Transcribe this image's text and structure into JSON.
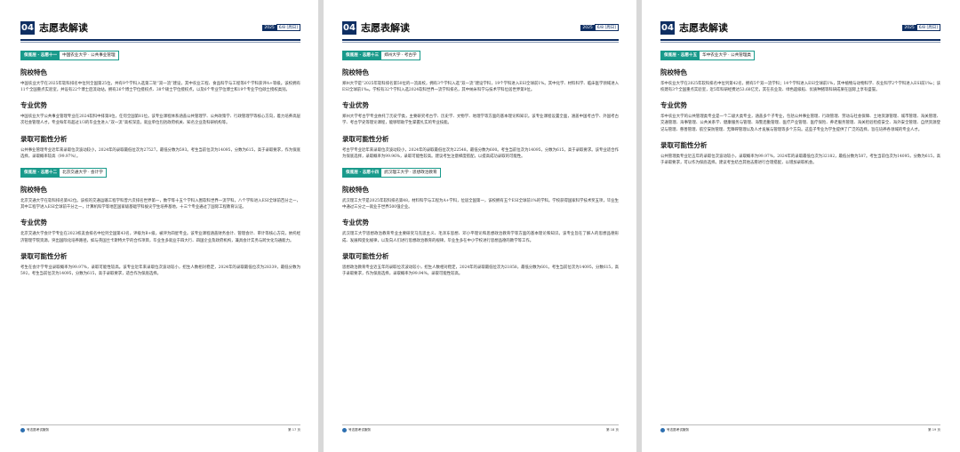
{
  "header": {
    "number": "04",
    "title": "志愿表解读",
    "year": "2025",
    "month_day": "6/8",
    "weekday": "[周日]"
  },
  "footer": {
    "brand": "号志愿考试服务"
  },
  "pages": [
    {
      "page_number": "第 17 页",
      "blocks": [
        {
          "tag_kind": "保底层 · 志愿十一",
          "tag_name": "中国农业大学 · 公共事业管理",
          "sections": [
            {
              "heading": "院校特色",
              "text": "中国农业大学在2025年软科排名中位列全国第25位，共有9个学科入选第二轮“双一流”建设，其中农业工程、食品科学与工程等6个学科获评A+等级。该校拥有11个全国重点实验室，并设有22个博士后流动站，拥有26个博士学位授权点、38个硕士学位授权点，以及6个专业学位博士和19个专业学位硕士授权类别。"
            },
            {
              "heading": "专业优势",
              "text": "中国农业大学公共事业管理专业在2024软科中排第8位，任何全国第81位。该专业课程体系涵盖公共管理学、公共政策学、行政管理学等核心方向，着力培养高层次社会管理人才。专业每年有超过1/3的毕业生进入“双一流”高校深造，就业单位包括政府机关、知名企业及科研机构等。"
            },
            {
              "heading": "录取可能性分析",
              "text": "公共事业管理专业近年来录取位次波动较小，2024年的录取最低位次为27527，最低分数为593。考生当前位次为14095，分数为615，高于录取要求，作为保底选择，录取概率较高（99.97%）。"
            }
          ]
        },
        {
          "tag_kind": "保底层 · 志愿十二",
          "tag_name": "北京交通大学 · 会计学",
          "sections": [
            {
              "heading": "院校特色",
              "text": "北京交通大学在软科排名第42位。该校的交通运输工程学科曾六次排名世界第一，数学等十五个学科入围软科世界一流学科，八个学科进入ESI全球前百分之一，其中工程学进入ESI全球前千分之一，计算机科学等地区国家级基础学科拔尖学生培养基地，十三个专业通过了国际工程教育认证。"
            },
            {
              "heading": "专业优势",
              "text": "北京交通大学会计学专业在2023校友会排名中位列全国第43名，评级为B+级，被评为四星专业。该专业课程涵盖财务会计、管理会计、审计等核心方向，依托经济管理学院资源，突出国际化培养路径，如与英国兰卡斯特大学的合作项目，毕业生多就业于四大行、四国企业及政府机构，兼具会计实务与跨文化沟通能力。"
            },
            {
              "heading": "录取可能性分析",
              "text": "考生在会计学专业录取概率为99.97%，录取可能性较高。该专业近年来录取位次波动较小，招生人数相对稳定，2024年的录取最低位次为28339，最低分数为592，考生当前位次为14095，分数为615，高于录取要求，适合作为保底选择。"
            }
          ]
        }
      ]
    },
    {
      "page_number": "第 18 页",
      "blocks": [
        {
          "tag_kind": "保底层 · 志愿十三",
          "tag_name": "郑州大学 · 考古学",
          "sections": [
            {
              "heading": "院校特色",
              "text": "郑州大学是“2025年软科排名第50位的一流高校，拥有3个学科入选“双一流”建设学科，19个学科进入ESI全球前1%。其中化学、材料科学、临床医学领域进入ESI全球前1‰。学校有32个学科入选2024软科世界一流学科排名，其中纳米科学与技术学科位居世界第9位。"
            },
            {
              "heading": "专业优势",
              "text": "郑州大学考古学专业依托了历史学类，主要研究考古学、历史学、文物学、地理学等方面的基本理论和知识。该专业课程设置全面，涵盖中国考古学、外国考古学、考古学史等理论课程，能够帮助学生掌握扎实的专业技能。"
            },
            {
              "heading": "录取可能性分析",
              "text": "考古学专业近年来录取位次波动较小，2024年的录取最低位次为22548，最低分数为600。考生当前位次为14095，分数为615，高于录取要求。该专业适合作为保底选择，录取概率为99.96%，录取可能性较高。建议考生注意梯度搭配，以提高成功录取的可能性。"
            }
          ]
        },
        {
          "tag_kind": "保底层 · 志愿十四",
          "tag_name": "武汉理工大学 · 思想政治教育",
          "sections": [
            {
              "heading": "院校特色",
              "text": "武汉理工大学是2025年软科排名第48，材料科学与工程为A+学科，位居全国第一，该校拥有五个ESI全球前1%的学科。学校获得国家科学技术奖五项，毕业生中通过三分之一就业于世界500强企业。"
            },
            {
              "heading": "专业优势",
              "text": "武汉理工大学思想政治教育专业主要研究马克思主义、毛泽东思想、邓小平理论和思想政治教育学等方面的基本理论和知识。该专业旨在了解人的思想品德形成、发展和变化规律，以及向人们进行思想政治教育的规律。毕业生多在中小学校进行思想品德的教学等工作。"
            },
            {
              "heading": "录取可能性分析",
              "text": "思想政治教育专业近五年的录取位次波动较小，招生人数相对稳定，2024年的录取最低位次为21858，最低分数为601。考生当前位次为14095，分数615，高于录取要求，作为保底选择，录取概率为99.94%，录取可能性较高。"
            }
          ]
        }
      ]
    },
    {
      "page_number": "第 19 页",
      "blocks": [
        {
          "tag_kind": "保底层 · 志愿十五",
          "tag_name": "华中农业大学 · 公共管理类",
          "sections": [
            {
              "heading": "院校特色",
              "text": "华中农业大学在2025年软科排名中位列第42名，拥有5个双一流学科；14个学科进入ESI全球前1%，其中植物与动物科学、农业科学2个学科进入ESI前1‰；该校建有3个全国重点实验室，近5年科研经费达53.68亿元，其在农业及、绿色超级稻、优质种猪等科研成果在国际上享有盛誉。"
            },
            {
              "heading": "专业优势",
              "text": "华中农业大学的公共管理类专业是一个二级大类专业，涵盖多个子专业，包括公共事业管理、行政管理、劳动与社会保障、土地资源管理、城市管理、海关管理、交通管理、海事管理、公共关系学、健康服务与管理、海警后勤管理、医疗产业管理、医疗保险、养老服务管理、海关检验检疫安全、海外安全管理、自然资源登记与管理、慈善管理、航空安防管理、无障碍管理以及人才发展与管理等多个方向。这些子专业为学生提供了广泛的选择，旨在培养各领域的专业人才。"
            },
            {
              "heading": "录取可能性分析",
              "text": "公共管理类专业近五年的录取位次波动较小，录取概率为99.97%，2024年的录取最低位次为32182，最低分数为587。考生当前位次为14095，分数为615，高于录取要求，可以作为保底选择。建议考生结合其他志愿进行合理搭配，以增加录取机会。"
            }
          ]
        }
      ]
    }
  ]
}
